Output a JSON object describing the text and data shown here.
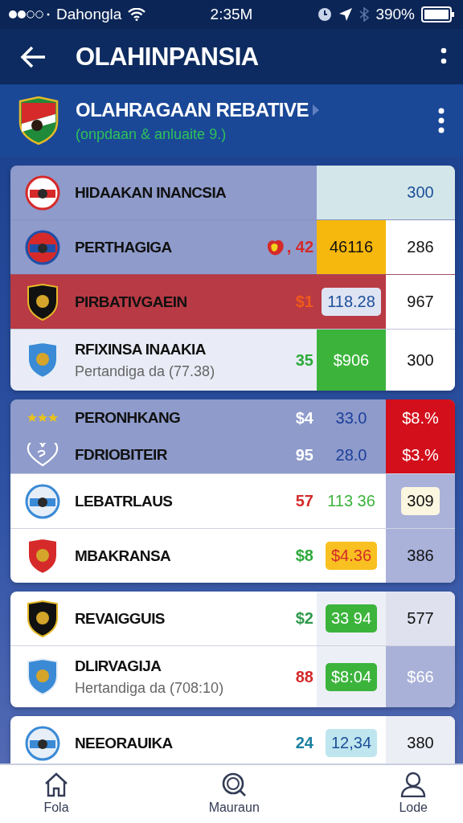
{
  "status_bar": {
    "carrier": "Dahongla",
    "time": "2:35M",
    "battery": "390%"
  },
  "app_bar": {
    "title": "OLAHINPANSIA"
  },
  "league": {
    "title": "OLAHRAGAAN REBATIVE",
    "subtitle": "(onpdaan & anluaite 9.)"
  },
  "cards": [
    {
      "rows": [
        {
          "name": "HIDAAKAN INANCSIA",
          "kind": "round",
          "color": "#8e9bcb",
          "col_b": {
            "bg": {
              "color": "#d3e6ea"
            }
          },
          "col_c": {
            "text": "300",
            "color": "#1d4f9a",
            "bg": {
              "color": "#d3e6ea"
            }
          }
        },
        {
          "name": "PERTHAGIGA",
          "kind": "round",
          "color": "#8e9bcb",
          "col_a": {
            "text": ", 42",
            "color": "#d42a2a",
            "icon": true
          },
          "col_b": {
            "text": "46116",
            "color": "#111111",
            "bg": {
              "color": "#f6b80c"
            }
          },
          "col_c": {
            "text": "286",
            "color": "#111111",
            "bg": {
              "color": "#ffffff"
            }
          }
        },
        {
          "name": "PIRBATIVGAEIN",
          "kind": "shield",
          "color": "#b83a44",
          "col_a": {
            "text": "$1",
            "color": "#f05a1a"
          },
          "col_b": {
            "text": "118.28",
            "color": "#1d4f9a",
            "badge": {
              "color": "#dfe4f3"
            }
          },
          "col_c": {
            "text": "967",
            "color": "#111111",
            "bg": {
              "color": "#ffffff"
            }
          }
        },
        {
          "name": "RFIXINSA INAAKIA",
          "sub": "Pertandiga da (77.38)",
          "kind": "shield",
          "color": "#e9ecf6",
          "col_a": {
            "text": "35",
            "color": "#2eaa3c"
          },
          "col_b": {
            "text": "$906",
            "color": "#ffffff",
            "bg": {
              "color": "#3cb43c"
            }
          },
          "col_c": {
            "text": "300",
            "color": "#111111",
            "bg": {
              "color": "#ffffff"
            }
          }
        }
      ]
    },
    {
      "rows": [
        {
          "name": "PERONHKANG",
          "kind": "stars",
          "color": "#8e9bcb",
          "col_a": {
            "text": "$4",
            "color": "#ffffff"
          },
          "col_b": {
            "text": "33.0",
            "color": "#1d3f9a"
          },
          "col_c": {
            "text": "$8.%",
            "color": "#ffffff",
            "bg": {
              "color": "#d30f1c"
            }
          }
        },
        {
          "name": "FDRIOBITEIR",
          "kind": "heart",
          "color": "#8e9bcb",
          "col_a": {
            "text": "95",
            "color": "#ffffff"
          },
          "col_b": {
            "text": "28.0",
            "color": "#1d3f9a"
          },
          "col_c": {
            "text": "$3.%",
            "color": "#ffffff",
            "bg": {
              "color": "#d30f1c"
            }
          }
        },
        {
          "name": "LEBATRLAUS",
          "kind": "round",
          "color": "#ffffff",
          "col_a": {
            "text": "57",
            "color": "#d42a2a"
          },
          "col_b": {
            "text": "113 36",
            "color": "#3cb43c"
          },
          "col_c": {
            "text": "309",
            "color": "#111111",
            "bg": {
              "color": "#aab2da"
            },
            "badge": {
              "color": "#fbf6e0"
            }
          }
        },
        {
          "name": "MBAKRANSA",
          "kind": "shield",
          "color": "#ffffff",
          "col_a": {
            "text": "$8",
            "color": "#2eaa3c"
          },
          "col_b": {
            "text": "$4.36",
            "color": "#d42a2a",
            "badge": {
              "color": "#f8c020"
            }
          },
          "col_c": {
            "text": "386",
            "color": "#111111",
            "bg": {
              "color": "#aab2da"
            }
          }
        }
      ]
    },
    {
      "rows": [
        {
          "name": "REVAIGGUIS",
          "kind": "shield",
          "color": "#ffffff",
          "col_a": {
            "text": "$2",
            "color": "#2e9a4c"
          },
          "col_b": {
            "text": "33 94",
            "color": "#ffffff",
            "bg": {
              "color": "#eceff6"
            },
            "badge": {
              "color": "#3cb43c"
            }
          },
          "col_c": {
            "text": "577",
            "color": "#111111",
            "bg": {
              "color": "#dfe2ee"
            }
          }
        },
        {
          "name": "DLIRVAGIJA",
          "sub": "Hertandiga da (708:10)",
          "kind": "shield",
          "color": "#ffffff",
          "col_a": {
            "text": "88",
            "color": "#d42a2a"
          },
          "col_b": {
            "text": "$8:04",
            "color": "#ffffff",
            "bg": {
              "color": "#eceff6"
            },
            "badge": {
              "color": "#3cb43c"
            }
          },
          "col_c": {
            "text": "$66",
            "color": "#ffffff",
            "bg": {
              "color": "#a9b1d8"
            }
          }
        }
      ]
    },
    {
      "rows": [
        {
          "name": "NEEORAUIKA",
          "kind": "round",
          "color": "#ffffff",
          "col_a": {
            "text": "24",
            "color": "#1a7fa0"
          },
          "col_b": {
            "text": "12,34",
            "color": "#1d4f9a",
            "badge": {
              "color": "#bfe6ee"
            }
          },
          "col_c": {
            "text": "380",
            "color": "#111111",
            "bg": {
              "color": "#eceef5"
            }
          }
        }
      ]
    }
  ],
  "nav": [
    {
      "label": "Fola",
      "selected": false
    },
    {
      "label": "Mauraun",
      "selected": false
    },
    {
      "label": "Lode",
      "selected": false
    }
  ]
}
